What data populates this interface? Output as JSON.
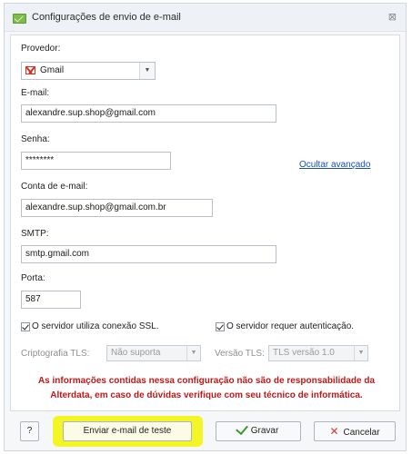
{
  "window": {
    "title": "Configurações de envio de e-mail",
    "close_glyph": "⊠"
  },
  "form": {
    "provider_label": "Provedor:",
    "provider_value": "Gmail",
    "email_label": "E-mail:",
    "email_value": "alexandre.sup.shop@gmail.com",
    "password_label": "Senha:",
    "password_value": "********",
    "advanced_link": "Ocultar avançado",
    "account_label": "Conta de e-mail:",
    "account_value": "alexandre.sup.shop@gmail.com.br",
    "smtp_label": "SMTP:",
    "smtp_value": "smtp.gmail.com",
    "port_label": "Porta:",
    "port_value": "587",
    "ssl_label": "O servidor utiliza conexão SSL.",
    "ssl_checked": true,
    "auth_label": "O servidor requer autenticação.",
    "auth_checked": true,
    "tls_crypto_label": "Criptografia TLS:",
    "tls_crypto_value": "Não suporta",
    "tls_version_label": "Versão TLS:",
    "tls_version_value": "TLS versão 1.0",
    "warning_line1": "As informações contidas nessa configuração não são de responsabilidade da",
    "warning_line2": "Alterdata, em caso de dúvidas verifique com seu técnico de informática."
  },
  "buttons": {
    "help": "?",
    "test_email": "Enviar e-mail de teste",
    "save": "Gravar",
    "cancel": "Cancelar"
  },
  "icons": {
    "title": "email-settings-icon",
    "provider": "gmail-icon",
    "save": "checkmark-icon",
    "cancel": "x-icon"
  },
  "colors": {
    "warning": "#c01818",
    "highlight": "#f3f525",
    "link": "#1a4fb5"
  }
}
